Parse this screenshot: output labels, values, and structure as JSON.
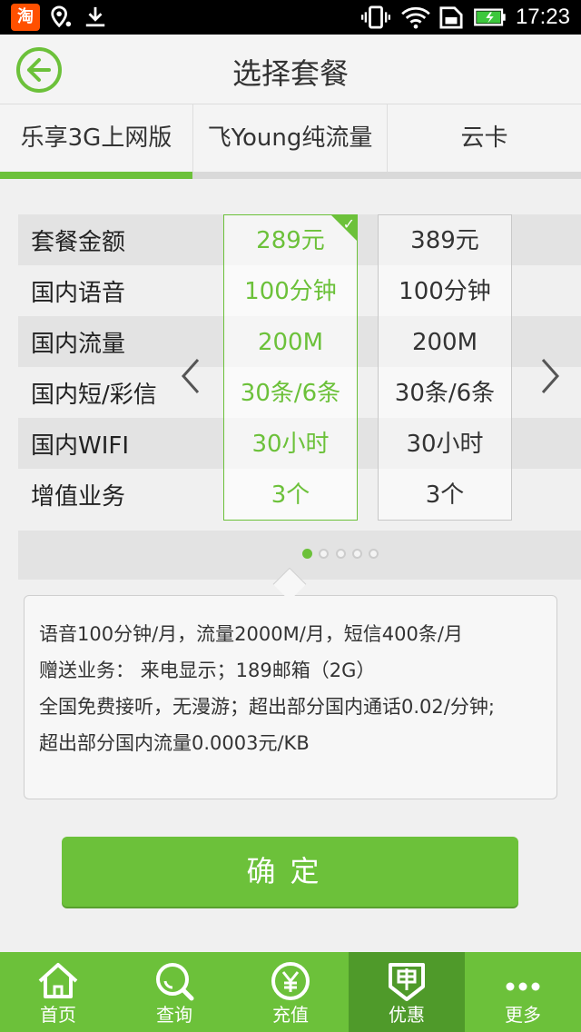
{
  "status_bar": {
    "time": "17:23",
    "taobao_glyph": "淘"
  },
  "header": {
    "title": "选择套餐"
  },
  "tabs": [
    {
      "label": "乐享3G上网版",
      "active": true
    },
    {
      "label": "飞Young纯流量",
      "active": false
    },
    {
      "label": "云卡",
      "active": false
    }
  ],
  "table": {
    "row_labels": [
      "套餐金额",
      "国内语音",
      "国内流量",
      "国内短/彩信",
      "国内WIFI",
      "增值业务"
    ],
    "plans": [
      {
        "selected": true,
        "values": [
          "289元",
          "100分钟",
          "200M",
          "30条/6条",
          "30小时",
          "3个"
        ]
      },
      {
        "selected": false,
        "values": [
          "389元",
          "100分钟",
          "200M",
          "30条/6条",
          "30小时",
          "3个"
        ]
      }
    ],
    "pager": {
      "pages": 5,
      "current": 1
    }
  },
  "description": {
    "lines": [
      "语音100分钟/月，流量2000M/月，短信400条/月",
      "赠送业务： 来电显示；189邮箱（2G）",
      "全国免费接听，无漫游；超出部分国内通话0.02/分钟;",
      "超出部分国内流量0.0003元/KB"
    ]
  },
  "confirm_label": "确定",
  "bottom_nav": [
    {
      "label": "首页",
      "icon": "home-icon",
      "active": false
    },
    {
      "label": "查询",
      "icon": "search-icon",
      "active": false
    },
    {
      "label": "充值",
      "icon": "yuan-icon",
      "active": false
    },
    {
      "label": "优惠",
      "icon": "coupon-icon",
      "active": true
    },
    {
      "label": "更多",
      "icon": "more-icon",
      "active": false
    }
  ],
  "colors": {
    "accent": "#6cc13a",
    "accent_dark": "#4f9a2a"
  }
}
